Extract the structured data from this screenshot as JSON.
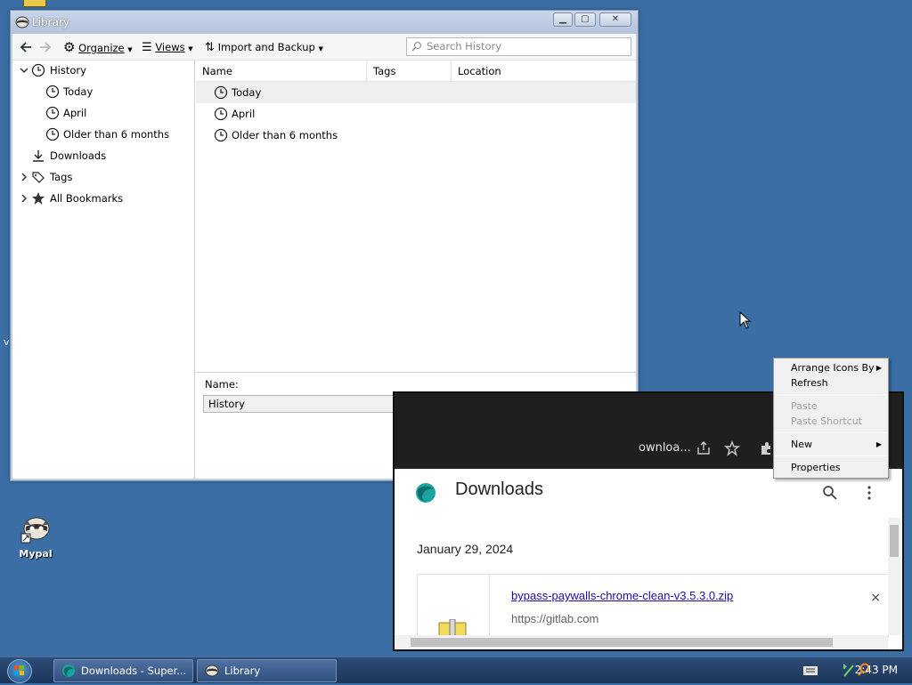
{
  "desktop": {
    "icons": [
      {
        "label": "Mypal"
      }
    ],
    "stray_text": "v"
  },
  "library": {
    "title": "Library",
    "toolbar": {
      "organize": "Organize",
      "views": "Views",
      "import_backup": "Import and Backup",
      "search_placeholder": "Search History"
    },
    "tree": [
      {
        "label": "History"
      },
      {
        "label": "Today"
      },
      {
        "label": "April"
      },
      {
        "label": "Older than 6 months"
      },
      {
        "label": "Downloads"
      },
      {
        "label": "Tags"
      },
      {
        "label": "All Bookmarks"
      }
    ],
    "columns": [
      "Name",
      "Tags",
      "Location"
    ],
    "rows": [
      {
        "name": "Today"
      },
      {
        "name": "April"
      },
      {
        "name": "Older than 6 months"
      }
    ],
    "details": {
      "name_label": "Name:",
      "name_value": "History"
    }
  },
  "chrome": {
    "tab_text": "ownloa...",
    "page_title": "Downloads",
    "date": "January 29, 2024",
    "file_name": "bypass-paywalls-chrome-clean-v3.5.3.0.zip",
    "file_url": "https://gitlab.com",
    "remove_glyph": "×"
  },
  "context_menu": {
    "arrange": "Arrange Icons By",
    "refresh": "Refresh",
    "paste": "Paste",
    "paste_shortcut": "Paste Shortcut",
    "new": "New",
    "properties": "Properties"
  },
  "taskbar": {
    "items": [
      {
        "label": "Downloads - Super..."
      },
      {
        "label": "Library"
      }
    ],
    "clock": "2:43 PM"
  }
}
